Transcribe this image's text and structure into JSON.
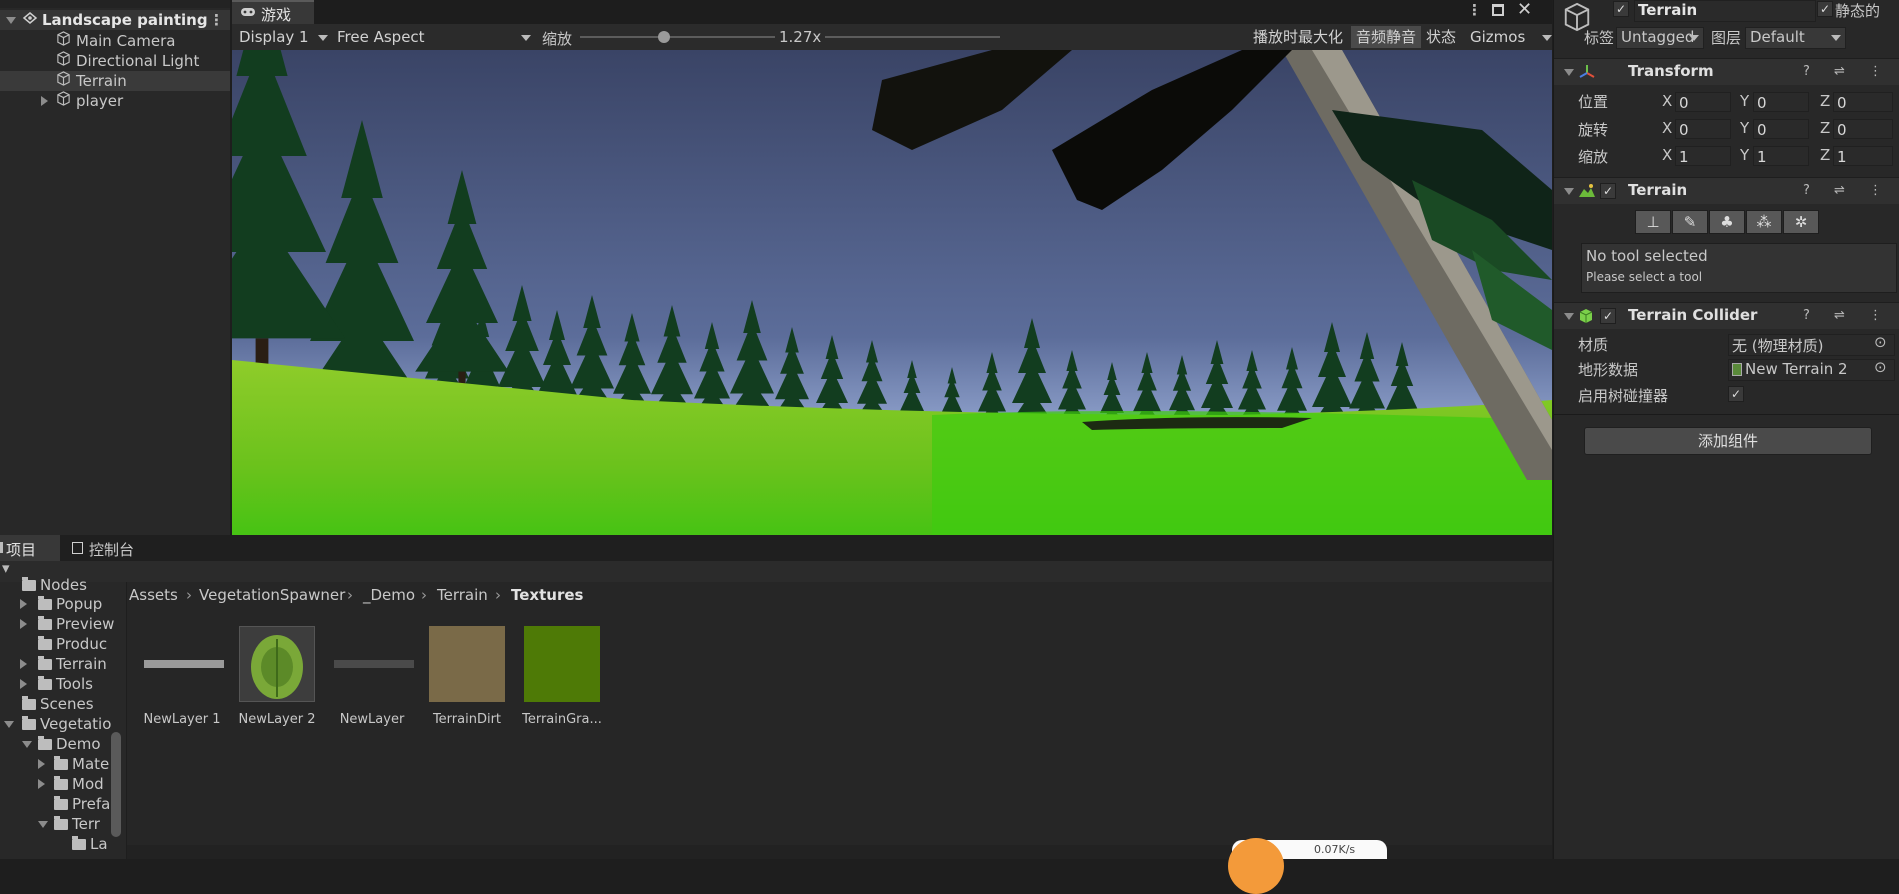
{
  "hierarchy": {
    "scene_name": "Landscape painting",
    "items": [
      "Main Camera",
      "Directional Light",
      "Terrain",
      "player"
    ]
  },
  "game_view": {
    "tab_label": "游戏",
    "display": "Display 1",
    "aspect": "Free Aspect",
    "scale_label": "缩放",
    "scale_value": "1.27x",
    "scale_fraction": 0.2,
    "maximize_on_play": "播放时最大化",
    "mute_audio": "音频静音",
    "stats": "状态",
    "gizmos": "Gizmos"
  },
  "inspector": {
    "object_name": "Terrain",
    "static_label": "静态的",
    "tag_label": "标签",
    "tag_value": "Untagged",
    "layer_label": "图层",
    "layer_value": "Default",
    "transform": {
      "title": "Transform",
      "position_label": "位置",
      "rotation_label": "旋转",
      "scale_label": "缩放",
      "axes": [
        "X",
        "Y",
        "Z"
      ],
      "position": [
        "0",
        "0",
        "0"
      ],
      "rotation": [
        "0",
        "0",
        "0"
      ],
      "scale": [
        "1",
        "1",
        "1"
      ]
    },
    "terrain": {
      "title": "Terrain",
      "no_tool": "No tool selected",
      "please_select": "Please select a tool"
    },
    "collider": {
      "title": "Terrain Collider",
      "material_label": "材质",
      "material_value": "无 (物理材质)",
      "data_label": "地形数据",
      "data_value": "New Terrain 2",
      "enable_trees_label": "启用树碰撞器"
    },
    "add_component": "添加组件"
  },
  "project": {
    "tab_project": "项目",
    "tab_console": "控制台",
    "tree": [
      "Nodes",
      "Popup",
      "Preview",
      "Produc",
      "Terrain",
      "Tools",
      "Scenes",
      "Vegetatio",
      "Demo",
      "Mate",
      "Mod",
      "Prefa",
      "Terr",
      "La"
    ],
    "breadcrumb": [
      "Assets",
      "VegetationSpawner",
      "_Demo",
      "Terrain",
      "Textures"
    ],
    "assets": [
      "NewLayer 1",
      "NewLayer 2",
      "NewLayer",
      "TerrainDirt",
      "TerrainGra..."
    ],
    "net_speed": "0.07K/s"
  }
}
